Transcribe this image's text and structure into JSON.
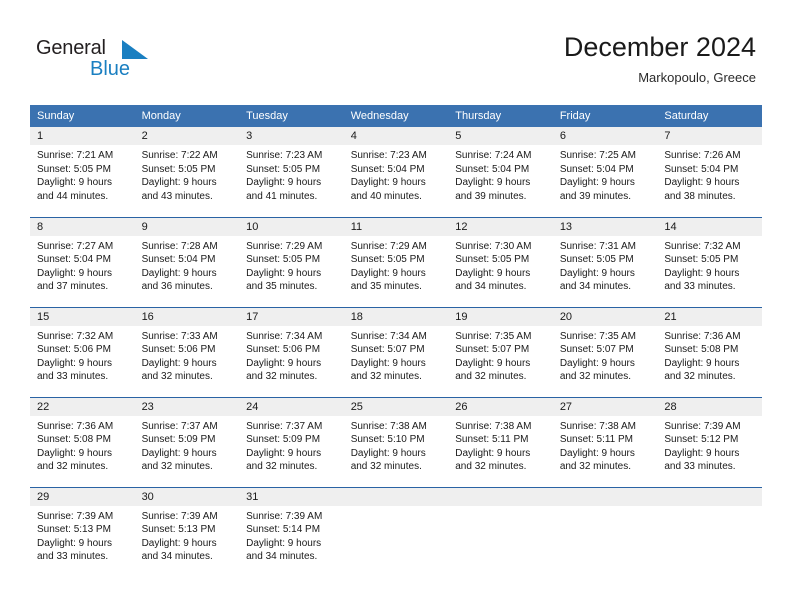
{
  "brand": {
    "name_part1": "General",
    "name_part2": "Blue",
    "triangle_icon": "triangle-icon",
    "accent_color": "#1a7fc1"
  },
  "header": {
    "title": "December 2024",
    "subtitle": "Markopoulo, Greece"
  },
  "calendar": {
    "header_bg": "#3b72b0",
    "row_border_color": "#2a63a4",
    "daynum_bg": "#efefef",
    "weekday_headers": [
      "Sunday",
      "Monday",
      "Tuesday",
      "Wednesday",
      "Thursday",
      "Friday",
      "Saturday"
    ],
    "weeks": [
      [
        {
          "day": "1",
          "sunrise": "Sunrise: 7:21 AM",
          "sunset": "Sunset: 5:05 PM",
          "daylight1": "Daylight: 9 hours",
          "daylight2": "and 44 minutes."
        },
        {
          "day": "2",
          "sunrise": "Sunrise: 7:22 AM",
          "sunset": "Sunset: 5:05 PM",
          "daylight1": "Daylight: 9 hours",
          "daylight2": "and 43 minutes."
        },
        {
          "day": "3",
          "sunrise": "Sunrise: 7:23 AM",
          "sunset": "Sunset: 5:05 PM",
          "daylight1": "Daylight: 9 hours",
          "daylight2": "and 41 minutes."
        },
        {
          "day": "4",
          "sunrise": "Sunrise: 7:23 AM",
          "sunset": "Sunset: 5:04 PM",
          "daylight1": "Daylight: 9 hours",
          "daylight2": "and 40 minutes."
        },
        {
          "day": "5",
          "sunrise": "Sunrise: 7:24 AM",
          "sunset": "Sunset: 5:04 PM",
          "daylight1": "Daylight: 9 hours",
          "daylight2": "and 39 minutes."
        },
        {
          "day": "6",
          "sunrise": "Sunrise: 7:25 AM",
          "sunset": "Sunset: 5:04 PM",
          "daylight1": "Daylight: 9 hours",
          "daylight2": "and 39 minutes."
        },
        {
          "day": "7",
          "sunrise": "Sunrise: 7:26 AM",
          "sunset": "Sunset: 5:04 PM",
          "daylight1": "Daylight: 9 hours",
          "daylight2": "and 38 minutes."
        }
      ],
      [
        {
          "day": "8",
          "sunrise": "Sunrise: 7:27 AM",
          "sunset": "Sunset: 5:04 PM",
          "daylight1": "Daylight: 9 hours",
          "daylight2": "and 37 minutes."
        },
        {
          "day": "9",
          "sunrise": "Sunrise: 7:28 AM",
          "sunset": "Sunset: 5:04 PM",
          "daylight1": "Daylight: 9 hours",
          "daylight2": "and 36 minutes."
        },
        {
          "day": "10",
          "sunrise": "Sunrise: 7:29 AM",
          "sunset": "Sunset: 5:05 PM",
          "daylight1": "Daylight: 9 hours",
          "daylight2": "and 35 minutes."
        },
        {
          "day": "11",
          "sunrise": "Sunrise: 7:29 AM",
          "sunset": "Sunset: 5:05 PM",
          "daylight1": "Daylight: 9 hours",
          "daylight2": "and 35 minutes."
        },
        {
          "day": "12",
          "sunrise": "Sunrise: 7:30 AM",
          "sunset": "Sunset: 5:05 PM",
          "daylight1": "Daylight: 9 hours",
          "daylight2": "and 34 minutes."
        },
        {
          "day": "13",
          "sunrise": "Sunrise: 7:31 AM",
          "sunset": "Sunset: 5:05 PM",
          "daylight1": "Daylight: 9 hours",
          "daylight2": "and 34 minutes."
        },
        {
          "day": "14",
          "sunrise": "Sunrise: 7:32 AM",
          "sunset": "Sunset: 5:05 PM",
          "daylight1": "Daylight: 9 hours",
          "daylight2": "and 33 minutes."
        }
      ],
      [
        {
          "day": "15",
          "sunrise": "Sunrise: 7:32 AM",
          "sunset": "Sunset: 5:06 PM",
          "daylight1": "Daylight: 9 hours",
          "daylight2": "and 33 minutes."
        },
        {
          "day": "16",
          "sunrise": "Sunrise: 7:33 AM",
          "sunset": "Sunset: 5:06 PM",
          "daylight1": "Daylight: 9 hours",
          "daylight2": "and 32 minutes."
        },
        {
          "day": "17",
          "sunrise": "Sunrise: 7:34 AM",
          "sunset": "Sunset: 5:06 PM",
          "daylight1": "Daylight: 9 hours",
          "daylight2": "and 32 minutes."
        },
        {
          "day": "18",
          "sunrise": "Sunrise: 7:34 AM",
          "sunset": "Sunset: 5:07 PM",
          "daylight1": "Daylight: 9 hours",
          "daylight2": "and 32 minutes."
        },
        {
          "day": "19",
          "sunrise": "Sunrise: 7:35 AM",
          "sunset": "Sunset: 5:07 PM",
          "daylight1": "Daylight: 9 hours",
          "daylight2": "and 32 minutes."
        },
        {
          "day": "20",
          "sunrise": "Sunrise: 7:35 AM",
          "sunset": "Sunset: 5:07 PM",
          "daylight1": "Daylight: 9 hours",
          "daylight2": "and 32 minutes."
        },
        {
          "day": "21",
          "sunrise": "Sunrise: 7:36 AM",
          "sunset": "Sunset: 5:08 PM",
          "daylight1": "Daylight: 9 hours",
          "daylight2": "and 32 minutes."
        }
      ],
      [
        {
          "day": "22",
          "sunrise": "Sunrise: 7:36 AM",
          "sunset": "Sunset: 5:08 PM",
          "daylight1": "Daylight: 9 hours",
          "daylight2": "and 32 minutes."
        },
        {
          "day": "23",
          "sunrise": "Sunrise: 7:37 AM",
          "sunset": "Sunset: 5:09 PM",
          "daylight1": "Daylight: 9 hours",
          "daylight2": "and 32 minutes."
        },
        {
          "day": "24",
          "sunrise": "Sunrise: 7:37 AM",
          "sunset": "Sunset: 5:09 PM",
          "daylight1": "Daylight: 9 hours",
          "daylight2": "and 32 minutes."
        },
        {
          "day": "25",
          "sunrise": "Sunrise: 7:38 AM",
          "sunset": "Sunset: 5:10 PM",
          "daylight1": "Daylight: 9 hours",
          "daylight2": "and 32 minutes."
        },
        {
          "day": "26",
          "sunrise": "Sunrise: 7:38 AM",
          "sunset": "Sunset: 5:11 PM",
          "daylight1": "Daylight: 9 hours",
          "daylight2": "and 32 minutes."
        },
        {
          "day": "27",
          "sunrise": "Sunrise: 7:38 AM",
          "sunset": "Sunset: 5:11 PM",
          "daylight1": "Daylight: 9 hours",
          "daylight2": "and 32 minutes."
        },
        {
          "day": "28",
          "sunrise": "Sunrise: 7:39 AM",
          "sunset": "Sunset: 5:12 PM",
          "daylight1": "Daylight: 9 hours",
          "daylight2": "and 33 minutes."
        }
      ],
      [
        {
          "day": "29",
          "sunrise": "Sunrise: 7:39 AM",
          "sunset": "Sunset: 5:13 PM",
          "daylight1": "Daylight: 9 hours",
          "daylight2": "and 33 minutes."
        },
        {
          "day": "30",
          "sunrise": "Sunrise: 7:39 AM",
          "sunset": "Sunset: 5:13 PM",
          "daylight1": "Daylight: 9 hours",
          "daylight2": "and 34 minutes."
        },
        {
          "day": "31",
          "sunrise": "Sunrise: 7:39 AM",
          "sunset": "Sunset: 5:14 PM",
          "daylight1": "Daylight: 9 hours",
          "daylight2": "and 34 minutes."
        },
        {
          "day": "",
          "sunrise": "",
          "sunset": "",
          "daylight1": "",
          "daylight2": ""
        },
        {
          "day": "",
          "sunrise": "",
          "sunset": "",
          "daylight1": "",
          "daylight2": ""
        },
        {
          "day": "",
          "sunrise": "",
          "sunset": "",
          "daylight1": "",
          "daylight2": ""
        },
        {
          "day": "",
          "sunrise": "",
          "sunset": "",
          "daylight1": "",
          "daylight2": ""
        }
      ]
    ]
  }
}
